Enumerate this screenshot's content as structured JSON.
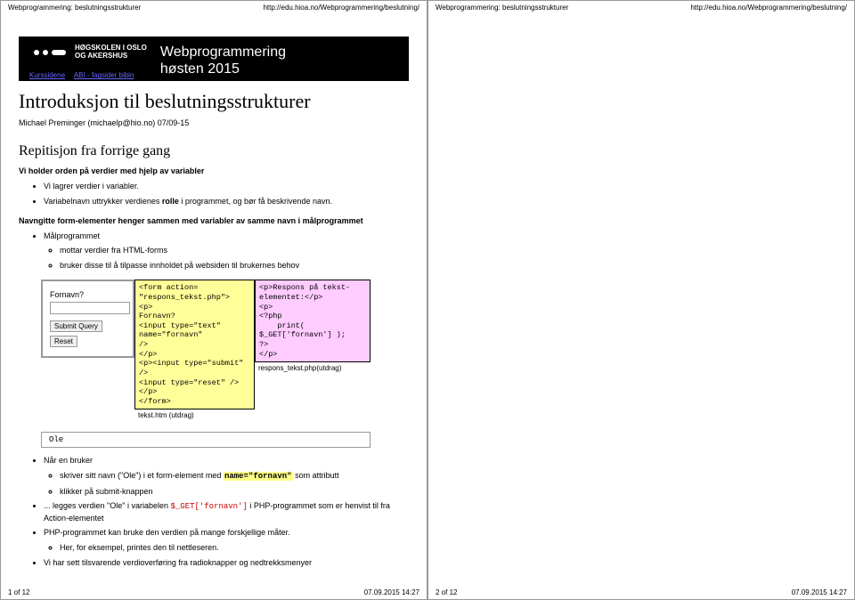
{
  "header": {
    "title_left": "Webprogrammering: beslutningsstrukturer",
    "url_right": "http://edu.hioa.no/Webprogrammering/beslutning/"
  },
  "footer": {
    "p1": "1 of 12",
    "p2": "2 of 12",
    "timestamp": "07.09.2015 14:27"
  },
  "banner": {
    "logo_line1": "HØGSKOLEN I OSLO",
    "logo_line2": "OG AKERSHUS",
    "title_line1": "Webprogrammering",
    "title_line2": "høsten 2015",
    "nav1": "Kurssidene",
    "nav2": "ABI - fagsider bibin"
  },
  "intro": {
    "h1": "Introduksjon til beslutningsstrukturer",
    "author": "Michael Preminger (michaelp@hio.no) 07/09-15"
  },
  "section1": {
    "h2": "Repitisjon fra forrige gang",
    "sub1": "Vi holder orden på verdier med hjelp av variabler",
    "b1": "Vi lagrer verdier i variabler.",
    "b2_a": "Variabelnavn uttrykker verdienes ",
    "b2_role": "rolle",
    "b2_b": " i programmet, og bør få beskrivende navn.",
    "sub2": "Navngitte form-elementer henger sammen med variabler av samme navn i målprogrammet",
    "b3": "Målprogrammet",
    "b3a": "mottar verdier fra HTML-forms",
    "b3b": "bruker disse til å tilpasse innholdet på websiden til brukernes behov"
  },
  "formbox": {
    "label": "Fornavn?",
    "btn1": "Submit Query",
    "btn2": "Reset"
  },
  "htmlcode": "<form action=\n\"respons_tekst.php\">\n<p>\nFornavn?\n<input type=\"text\"\nname=\"fornavn\"\n/>\n</p>\n<p><input type=\"submit\"\n/>\n<input type=\"reset\" />\n</p>\n</form>",
  "htmlcap": "tekst.htm (utdrag)",
  "phpcode": "<p>Respons på tekst-\nelementet:</p>\n<p>\n<?php\n    print(\n$_GET['fornavn'] );\n?>\n</p>",
  "phpcap": "respons_tekst.php(utdrag)",
  "ole": "Ole",
  "after": {
    "b1": "Når en bruker",
    "b1a_a": "skriver sitt navn (\"Ole\") i et form-element med ",
    "b1a_name": "name=\"fornavn\"",
    "b1a_b": " som attributt",
    "b1b": "klikker på submit-knappen",
    "b2_a": "... legges verdien \"Ole\" i variabelen ",
    "b2_get": "$_GET['fornavn']",
    "b2_b": " i PHP-programmet som er henvist til fra Action-elementet",
    "b3": "PHP-programmet kan bruke den verdien på mange forskjellige måter.",
    "b3a": "Her, for eksempel, printes den til nettleseren.",
    "b4": "Vi har sett tilsvarende verdioverføring fra radioknapper og nedtrekksmenyer"
  }
}
